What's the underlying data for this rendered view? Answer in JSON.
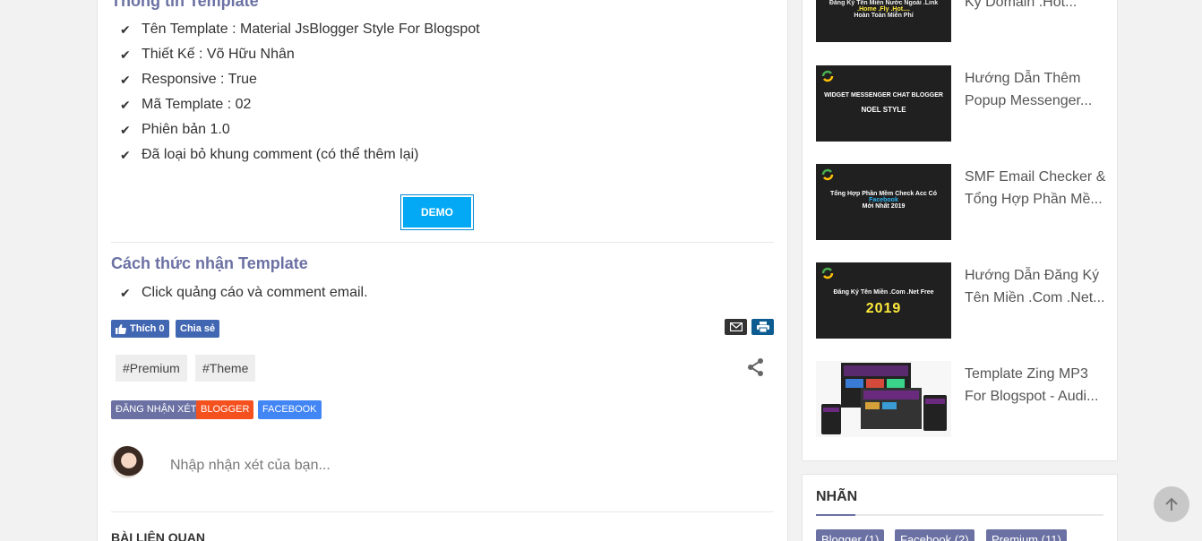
{
  "article": {
    "info_title": "Thông tin Template",
    "info_items": [
      "Tên Template : Material JsBlogger Style For Blogspot",
      "Thiết Kế : Võ Hữu Nhân",
      "Responsive : True",
      "Mã Template : 02",
      "Phiên bản 1.0",
      "Đã loại bỏ khung comment (có thể thêm lại)"
    ],
    "demo_label": "DEMO",
    "how_title": "Cách thức nhận Template",
    "how_items": [
      "Click quảng cáo và comment email."
    ]
  },
  "social": {
    "like_label": "Thích 0",
    "share_label": "Chia sẻ",
    "fb_color": "#4267b2",
    "email_color": "#333333",
    "print_color": "#0d5c91"
  },
  "tags": [
    "#Premium",
    "#Theme"
  ],
  "labels": [
    {
      "text": "Đăng nhận xét",
      "color": "#6b71a3"
    },
    {
      "text": "Blogger",
      "color": "#f4511e"
    },
    {
      "text": "Facebook",
      "color": "#4285f4"
    }
  ],
  "comment": {
    "placeholder": "Nhập nhận xét của bạn..."
  },
  "related": {
    "title": "BÀI LIÊN QUAN"
  },
  "sidebar": {
    "posts": [
      {
        "title": "Ký Domain .Hot...",
        "thumb_line1": "Đăng Ký Tên Miền Nước Ngoài .Link",
        "thumb_line2": ".Home .Fly .Hot....",
        "thumb_line3": "Hoàn Toàn Miễn Phí"
      },
      {
        "title": "Hướng Dẫn Thêm Popup Messenger...",
        "thumb_line1": "WIDGET MESSENGER CHAT BLOGGER",
        "thumb_line2": "NOEL STYLE"
      },
      {
        "title": "SMF Email Checker & Tổng Hợp Phần Mề...",
        "thumb_line1": "Tổng Hợp Phần Mềm Check Acc Có",
        "thumb_line2": "Facebook",
        "thumb_line3": "Mới Nhất 2019"
      },
      {
        "title": "Hướng Dẫn Đăng Ký Tên Miền .Com .Net...",
        "thumb_line1": "Đăng Ký Tên Miền .Com .Net Free",
        "thumb_line2": "2019"
      },
      {
        "title": "Template Zing MP3 For Blogspot - Audi..."
      }
    ],
    "labels_title": "NHÃN",
    "labels": [
      "Blogger (1)",
      "Facebook (2)",
      "Premium (11)"
    ]
  },
  "accent_color": "#6b71a3",
  "demo_color": "#03a9f4"
}
